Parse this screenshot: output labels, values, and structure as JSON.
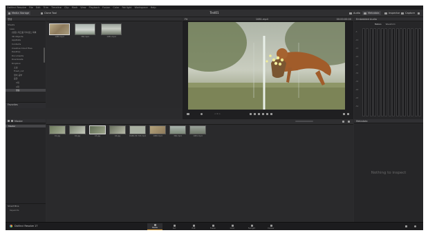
{
  "menu": [
    "DaVinci Resolve",
    "File",
    "Edit",
    "Trim",
    "Timeline",
    "Clip",
    "Mark",
    "View",
    "Playback",
    "Fusion",
    "Color",
    "Fairlight",
    "Workspace",
    "Help"
  ],
  "toolbar": {
    "media_storage": "Media Storage",
    "clone_tool": "Clone Tool",
    "project_title": "Test01",
    "audio": "Audio",
    "metadata": "Metadata",
    "inspector": "Inspector",
    "capture": "Capture"
  },
  "storage": {
    "location": "영상",
    "tree": [
      {
        "label": "Sheets",
        "indent": 0
      },
      {
        "label": "Lees",
        "indent": 1
      },
      {
        "label": "[영문] 재고품 라이센스 목록",
        "indent": 2
      },
      {
        "label": "3D Objects",
        "indent": 2
      },
      {
        "label": "AppData",
        "indent": 2
      },
      {
        "label": "Contacts",
        "indent": 2
      },
      {
        "label": "Creative Cloud Files",
        "indent": 2
      },
      {
        "label": "Desktop",
        "indent": 2
      },
      {
        "label": "Documents",
        "indent": 2
      },
      {
        "label": "Downloads",
        "indent": 2
      },
      {
        "label": "Dropbox",
        "indent": 2
      },
      {
        "label": "소설",
        "indent": 3
      },
      {
        "label": "Fresh_cut",
        "indent": 3
      },
      {
        "label": "영어 공부",
        "indent": 3
      },
      {
        "label": "음향",
        "indent": 3
      },
      {
        "label": "V대",
        "indent": 4
      },
      {
        "label": "A대",
        "indent": 4
      },
      {
        "label": "영상",
        "indent": 4,
        "selected": true
      }
    ],
    "favorites": "Favorites"
  },
  "browser_clips": [
    "1080.mp4",
    "360.mp4",
    "1081.mp4"
  ],
  "viewer": {
    "filename": "1081.mp4",
    "timecode": "00:00:00:00",
    "zoom": "Fit",
    "scrub_text": "< 0 >"
  },
  "audio_panel": {
    "title": "Embedded Audio",
    "tab_meters": "Meters",
    "tab_waveform": "Waveform",
    "scale": [
      "-5",
      "-10",
      "-15",
      "-20",
      "-25",
      "-30",
      "-35",
      "-40",
      "-45",
      "-50"
    ]
  },
  "media_pool": {
    "title": "Master",
    "bin": "Master",
    "clips": [
      "01.jpg",
      "02.jpg",
      "03.jpg",
      "04.jpg",
      "RGBA 8K 720.mp4",
      "1080.mp4",
      "360.mp4",
      "1081.mp4"
    ],
    "smart_bins": "Smart Bins",
    "smart_bins_item": "Keywords"
  },
  "metadata_panel": {
    "title": "Metadata",
    "empty": "Nothing to inspect"
  },
  "app_name": "DaVinci Resolve 17",
  "pages": [
    "Media",
    "Cut",
    "Edit",
    "Fusion",
    "Color",
    "Fairlight",
    "Deliver"
  ],
  "active_page": "Media"
}
